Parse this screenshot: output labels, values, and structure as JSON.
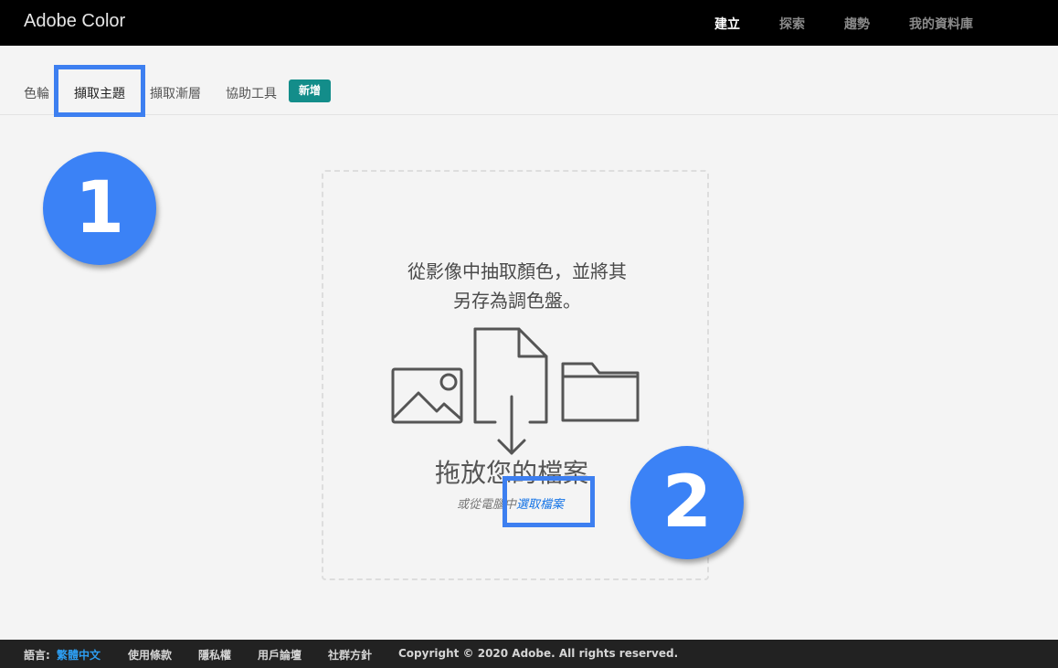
{
  "app": {
    "title": "Adobe Color"
  },
  "top_nav": [
    "建立",
    "探索",
    "趨勢",
    "我的資料庫"
  ],
  "tabs": [
    "色輪",
    "擷取主題",
    "擷取漸層",
    "協助工具"
  ],
  "badge": "新增",
  "dropzone": {
    "line1": "從影像中抽取顏色，並將其",
    "line2": "另存為調色盤。",
    "drop_label": "拖放您的檔案",
    "sub_prefix": "或從電腦中",
    "sub_link": "選取檔案"
  },
  "steps": [
    "1",
    "2"
  ],
  "footer": {
    "lang_label": "語言:",
    "lang_value": "繁體中文",
    "links": [
      "使用條款",
      "隱私權",
      "用戶論壇",
      "社群方針"
    ],
    "copyright": "Copyright © 2020 Adobe. All rights reserved."
  },
  "colors": {
    "accent": "#1473e6",
    "badge": "#138d8a",
    "highlight": "#3d7ff0",
    "step_circle": "#3b82f6"
  }
}
